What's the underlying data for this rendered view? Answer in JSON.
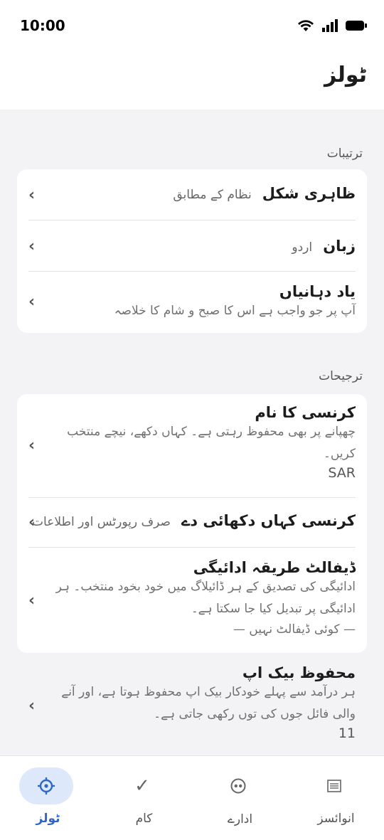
{
  "status_bar": {
    "time": "10:00",
    "icons": [
      "wifi-icon",
      "signal-icon",
      "battery-icon"
    ]
  },
  "header": {
    "title": "ٹولز"
  },
  "settings": {
    "label": "ترتیبات",
    "appearance": {
      "title": "ظاہری شکل",
      "value": "نظام کے مطابق"
    },
    "language": {
      "title": "زبان",
      "value": "اردو"
    },
    "reminders": {
      "title": "یاد دہانیاں",
      "desc": "آپ پر جو واجب ہے اس کا صبح و شام کا خلاصہ"
    }
  },
  "preferences": {
    "label": "ترجیحات",
    "currency_name": {
      "title": "کرنسی کا نام",
      "desc": "چھپانے پر بھی محفوظ رہتی ہے۔ کہاں دکھے، نیچے منتخب کریں۔",
      "value": "SAR"
    },
    "currency_show": {
      "title": "کرنسی کہاں دکھائی دے",
      "value": "صرف رپورٹس اور اطلاعات"
    },
    "default_payment": {
      "title": "ڈیفالٹ طریقہ ادائیگی",
      "desc": "ادائیگی کی تصدیق کے ہر ڈائیلاگ میں خود بخود منتخب۔ ہر ادائیگی پر تبدیل کیا جا سکتا ہے۔",
      "value": "— کوئی ڈیفالٹ نہیں —"
    }
  },
  "backup": {
    "title": "محفوظ بیک اپ",
    "desc": "ہر درآمد سے پہلے خودکار بیک اپ محفوظ ہوتا ہے، اور آنے والی فائل جوں کی توں رکھی جاتی ہے۔",
    "value": "11"
  },
  "nav": {
    "tools": "ٹولز",
    "tasks": "کام",
    "entities": "ادارے",
    "invoices": "انوائسز"
  },
  "colors": {
    "accent": "#2f66c8",
    "active_pill": "#dde9fb",
    "background": "#f3f3f5"
  }
}
